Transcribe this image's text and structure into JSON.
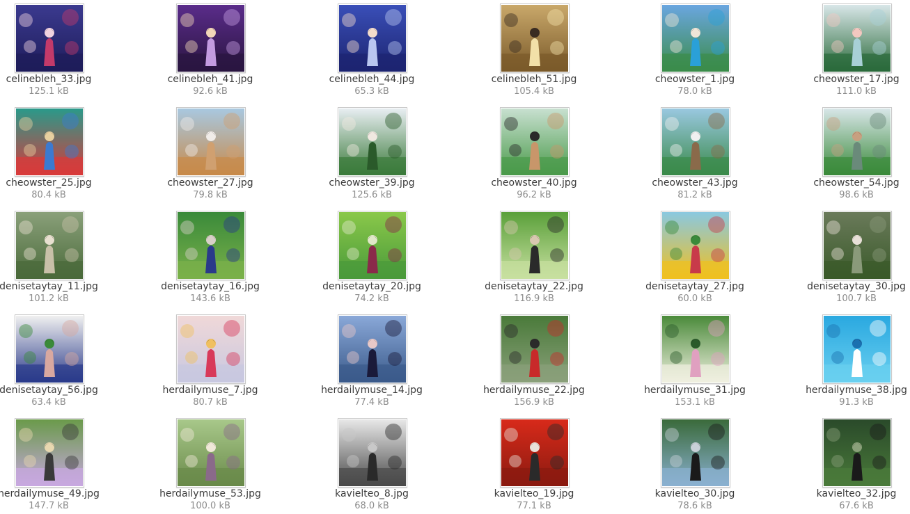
{
  "files": [
    {
      "name": "celinebleh_33.jpg",
      "size": "125.1 kB",
      "colors": [
        "#3b3a8f",
        "#1e1c5a",
        "#c33a6a",
        "#f0d2e0"
      ]
    },
    {
      "name": "celinebleh_41.jpg",
      "size": "92.6 kB",
      "colors": [
        "#5a2c8a",
        "#2a1540",
        "#c39be0",
        "#f2d6b8"
      ]
    },
    {
      "name": "celinebleh_44.jpg",
      "size": "65.3 kB",
      "colors": [
        "#3a4fb8",
        "#1c2470",
        "#b9c6f0",
        "#f4dccb"
      ]
    },
    {
      "name": "celinebleh_51.jpg",
      "size": "105.4 kB",
      "colors": [
        "#c9a86a",
        "#7a5a2a",
        "#f2e0a8",
        "#3a2c22"
      ]
    },
    {
      "name": "cheowster_1.jpg",
      "size": "78.0 kB",
      "colors": [
        "#6aa6e0",
        "#3b8c4a",
        "#2aa0d8",
        "#f0e6d8"
      ]
    },
    {
      "name": "cheowster_17.jpg",
      "size": "111.0 kB",
      "colors": [
        "#d8e6e8",
        "#2a6a3a",
        "#a8d0d6",
        "#f2c8c0"
      ]
    },
    {
      "name": "cheowster_25.jpg",
      "size": "80.4 kB",
      "colors": [
        "#2a9a8a",
        "#d83a3a",
        "#3c7ad0",
        "#e8d0a0"
      ]
    },
    {
      "name": "cheowster_27.jpg",
      "size": "79.8 kB",
      "colors": [
        "#a8c8e0",
        "#c88a4a",
        "#d0a070",
        "#f0ece8"
      ]
    },
    {
      "name": "cheowster_39.jpg",
      "size": "125.6 kB",
      "colors": [
        "#e8eef2",
        "#3a7a3a",
        "#2a5a2a",
        "#f0e8e0"
      ]
    },
    {
      "name": "cheowster_40.jpg",
      "size": "96.2 kB",
      "colors": [
        "#c8e0d0",
        "#4a9a4a",
        "#c8966a",
        "#2a2a2a"
      ]
    },
    {
      "name": "cheowster_43.jpg",
      "size": "81.2 kB",
      "colors": [
        "#9ac8e0",
        "#3a8a4a",
        "#8a6a4a",
        "#f0f0f0"
      ]
    },
    {
      "name": "cheowster_54.jpg",
      "size": "98.6 kB",
      "colors": [
        "#d8e6e8",
        "#3a8a3a",
        "#6a8a7a",
        "#c8a080"
      ]
    },
    {
      "name": "denisetaytay_11.jpg",
      "size": "101.2 kB",
      "colors": [
        "#8aa07a",
        "#4a6a3a",
        "#c8c0a8",
        "#e8e0d0"
      ]
    },
    {
      "name": "denisetaytay_16.jpg",
      "size": "143.6 kB",
      "colors": [
        "#3a8a3a",
        "#7ab04a",
        "#2a3a8a",
        "#d8d0c8"
      ]
    },
    {
      "name": "denisetaytay_20.jpg",
      "size": "74.2 kB",
      "colors": [
        "#8ac84a",
        "#4a9a3a",
        "#8a2a4a",
        "#e0e8c8"
      ]
    },
    {
      "name": "denisetaytay_22.jpg",
      "size": "116.9 kB",
      "colors": [
        "#5aa03a",
        "#c8e0a0",
        "#2a2a2a",
        "#d8c8b0"
      ]
    },
    {
      "name": "denisetaytay_27.jpg",
      "size": "60.0 kB",
      "colors": [
        "#8ac8e0",
        "#f0c020",
        "#c83a4a",
        "#3a8a3a"
      ]
    },
    {
      "name": "denisetaytay_30.jpg",
      "size": "100.7 kB",
      "colors": [
        "#6a7a5a",
        "#3a5a2a",
        "#8a9a7a",
        "#e8e0d8"
      ]
    },
    {
      "name": "denisetaytay_56.jpg",
      "size": "63.4 kB",
      "colors": [
        "#f0f0f0",
        "#2a3a8a",
        "#d8a8a0",
        "#3a8a3a"
      ]
    },
    {
      "name": "herdailymuse_7.jpg",
      "size": "80.7 kB",
      "colors": [
        "#f0d8d8",
        "#c8c8e0",
        "#d83a5a",
        "#f0c060"
      ]
    },
    {
      "name": "herdailymuse_14.jpg",
      "size": "77.4 kB",
      "colors": [
        "#8aa8d8",
        "#3a5a8a",
        "#1a1a3a",
        "#e8c8c8"
      ]
    },
    {
      "name": "herdailymuse_22.jpg",
      "size": "156.9 kB",
      "colors": [
        "#4a7a3a",
        "#8aa07a",
        "#c82a2a",
        "#2a2a2a"
      ]
    },
    {
      "name": "herdailymuse_31.jpg",
      "size": "153.1 kB",
      "colors": [
        "#4a8a3a",
        "#f0f0e0",
        "#e0a0c0",
        "#2a5a2a"
      ]
    },
    {
      "name": "herdailymuse_38.jpg",
      "size": "91.3 kB",
      "colors": [
        "#2aa8e0",
        "#6ad0f0",
        "#ffffff",
        "#1a70b0"
      ]
    },
    {
      "name": "herdailymuse_49.jpg",
      "size": "147.7 kB",
      "colors": [
        "#6a9a4a",
        "#c8a8e0",
        "#3a3a3a",
        "#e8d8b0"
      ]
    },
    {
      "name": "herdailymuse_53.jpg",
      "size": "100.0 kB",
      "colors": [
        "#a8c88a",
        "#6a8a4a",
        "#8a6a8a",
        "#f0e8d8"
      ]
    },
    {
      "name": "kavielteo_8.jpg",
      "size": "68.0 kB",
      "colors": [
        "#e8e8e8",
        "#4a4a4a",
        "#2a2a2a",
        "#c8c8c8"
      ]
    },
    {
      "name": "kavielteo_19.jpg",
      "size": "77.1 kB",
      "colors": [
        "#d82a1a",
        "#8a1a10",
        "#2a2a2a",
        "#e8e0d8"
      ]
    },
    {
      "name": "kavielteo_30.jpg",
      "size": "78.6 kB",
      "colors": [
        "#3a6a3a",
        "#8ab0d0",
        "#1a1a1a",
        "#c8d0d8"
      ]
    },
    {
      "name": "kavielteo_32.jpg",
      "size": "67.6 kB",
      "colors": [
        "#2a4a2a",
        "#4a7a3a",
        "#1a1a1a",
        "#8aa07a"
      ]
    }
  ]
}
